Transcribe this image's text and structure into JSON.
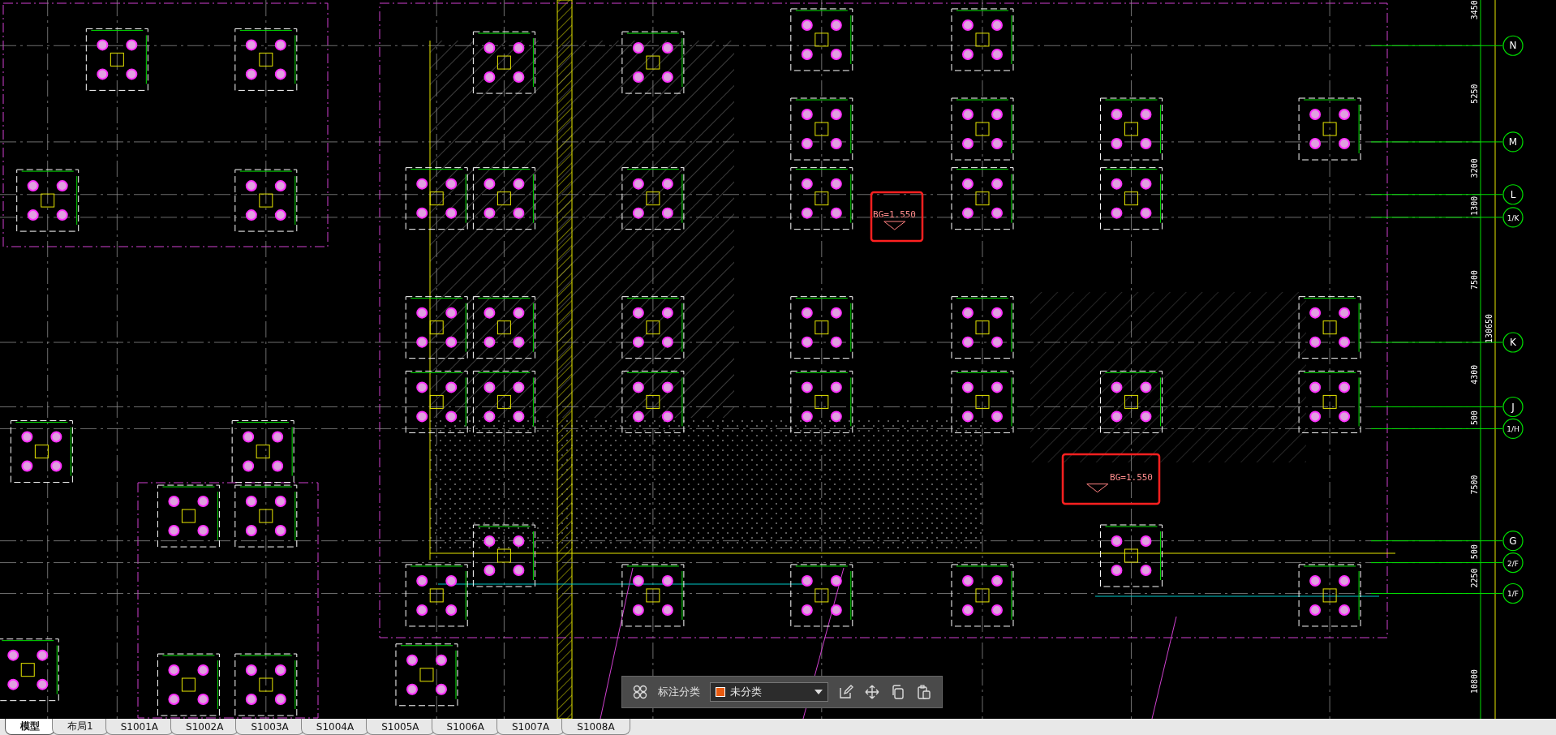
{
  "drawing": {
    "axes": [
      {
        "label": "N",
        "dimension": "3450"
      },
      {
        "label": "M",
        "dimension": "5250"
      },
      {
        "label": "L",
        "dimension": "3200"
      },
      {
        "label": "1/K",
        "dimension": "1300"
      },
      {
        "label": "K",
        "dimension": "7500"
      },
      {
        "label": "J",
        "dimension": "4300"
      },
      {
        "label": "1/H",
        "dimension": "500"
      },
      {
        "label": "G",
        "dimension": "7500"
      },
      {
        "label": "2/F",
        "dimension": "500"
      },
      {
        "label": "1/F",
        "dimension": "2250"
      }
    ],
    "bottom_dimension": "10800",
    "total_dimension": "130650",
    "highlighted_labels": [
      "BG=1.550",
      "BG=1.550"
    ]
  },
  "annotation_toolbar": {
    "label": "标注分类",
    "category": "未分类"
  },
  "tabs": [
    {
      "label": "模型",
      "selected": true
    },
    {
      "label": "布局1",
      "selected": false
    },
    {
      "label": "S1001A",
      "selected": false
    },
    {
      "label": "S1002A",
      "selected": false
    },
    {
      "label": "S1003A",
      "selected": false
    },
    {
      "label": "S1004A",
      "selected": false
    },
    {
      "label": "S1005A",
      "selected": false
    },
    {
      "label": "S1006A",
      "selected": false
    },
    {
      "label": "S1007A",
      "selected": false
    },
    {
      "label": "S1008A",
      "selected": false
    }
  ]
}
